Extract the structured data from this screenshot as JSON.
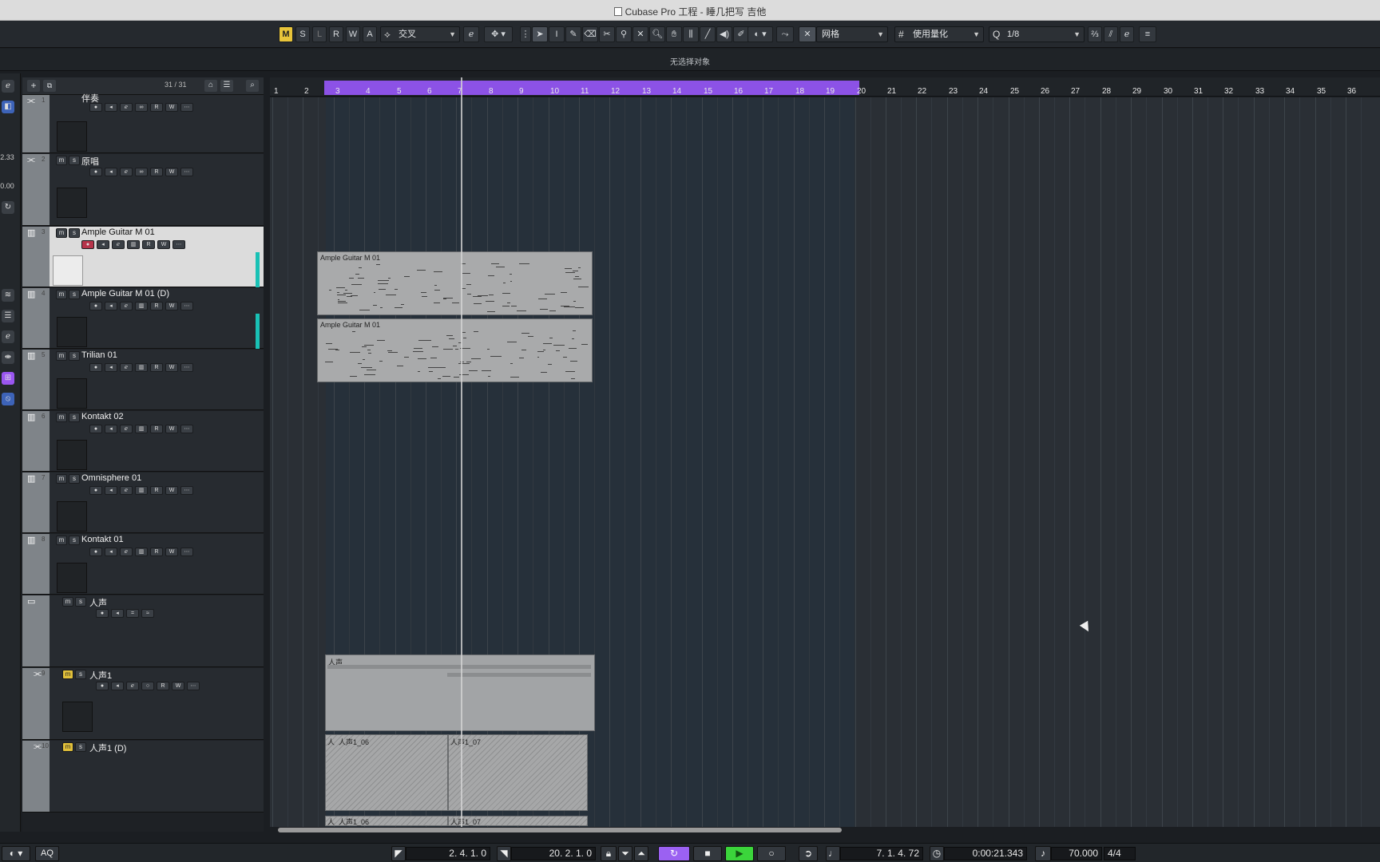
{
  "window": {
    "title": "Cubase Pro 工程 - 睡几把写 吉他"
  },
  "toolbar": {
    "modes": [
      "M",
      "S",
      "L",
      "R",
      "W",
      "A"
    ],
    "automation_mode": "交叉",
    "snap_type": "网格",
    "grid_type": "使用量化",
    "quantize_label": "Q",
    "quantize_value": "1/8"
  },
  "infoline": {
    "status": "无选择对象"
  },
  "tracklist": {
    "count": "31 / 31",
    "tracks": [
      {
        "num": "1",
        "name": "伴奏",
        "type": "audio"
      },
      {
        "num": "2",
        "name": "原唱",
        "type": "audio"
      },
      {
        "num": "3",
        "name": "Ample Guitar M 01",
        "type": "instrument",
        "selected": true
      },
      {
        "num": "4",
        "name": "Ample Guitar M 01 (D)",
        "type": "instrument"
      },
      {
        "num": "5",
        "name": "Trilian 01",
        "type": "instrument"
      },
      {
        "num": "6",
        "name": "Kontakt 02",
        "type": "instrument"
      },
      {
        "num": "7",
        "name": "Omnisphere 01",
        "type": "instrument"
      },
      {
        "num": "8",
        "name": "Kontakt 01",
        "type": "instrument"
      },
      {
        "num": "",
        "name": "人声",
        "type": "folder"
      },
      {
        "num": "9",
        "name": "人声1",
        "type": "audio"
      },
      {
        "num": "10",
        "name": "人声1 (D)",
        "type": "audio"
      }
    ],
    "btn_m": "m",
    "btn_s": "s",
    "btn_r": "R",
    "btn_w": "W"
  },
  "leftzone": {
    "value_a": "2.33",
    "value_b": "0.00"
  },
  "ruler": {
    "bars": [
      "1",
      "2",
      "3",
      "4",
      "5",
      "6",
      "7",
      "8",
      "9",
      "10",
      "11",
      "12",
      "13",
      "14",
      "15",
      "16",
      "17",
      "18",
      "19",
      "20",
      "21",
      "22",
      "23",
      "24",
      "25",
      "26",
      "27",
      "28",
      "29",
      "30",
      "31",
      "32",
      "33",
      "34",
      "35",
      "36"
    ]
  },
  "parts": {
    "guitar_1": "Ample Guitar M 01",
    "guitar_2": "Ample Guitar M 01",
    "folder": "人声",
    "vocal_a1": "人",
    "vocal_a2": "人声1_06",
    "vocal_b1": "人声1_07",
    "vocal_c1": "人",
    "vocal_c2": "人声1_06",
    "vocal_d1": "人声1_07"
  },
  "transport": {
    "left_locator": "2. 4. 1.   0",
    "right_locator": "20. 2. 1.   0",
    "position_bars": "7. 1. 4. 72",
    "position_time": "0:00:21.343",
    "tempo": "70.000",
    "signature": "4/4",
    "aq": "AQ"
  },
  "colors": {
    "loop": "#8c52e6",
    "play": "#3bd53b",
    "mode_on": "#e8c43a",
    "selected_track": "#dcdcdc",
    "meter": "#19c1b5"
  }
}
